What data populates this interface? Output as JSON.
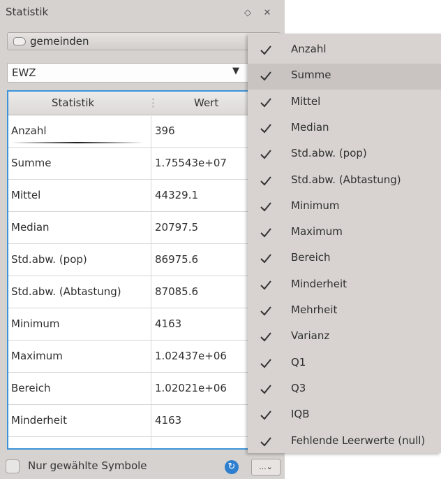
{
  "window": {
    "title": "Statistik"
  },
  "layer": {
    "name": "gemeinden"
  },
  "field": {
    "value": "EWZ"
  },
  "table": {
    "headers": [
      "Statistik",
      "Wert"
    ],
    "rows": [
      [
        "Anzahl",
        "396"
      ],
      [
        "Summe",
        "1.75543e+07"
      ],
      [
        "Mittel",
        "44329.1"
      ],
      [
        "Median",
        "20797.5"
      ],
      [
        "Std.abw. (pop)",
        "86975.6"
      ],
      [
        "Std.abw. (Abtastung)",
        "87085.6"
      ],
      [
        "Minimum",
        "4163"
      ],
      [
        "Maximum",
        "1.02437e+06"
      ],
      [
        "Bereich",
        "1.02021e+06"
      ],
      [
        "Minderheit",
        "4163"
      ]
    ]
  },
  "bottom": {
    "checkbox_label": "Nur gewählte Symbole",
    "more_label": "...⌄"
  },
  "menu": {
    "items": [
      "Anzahl",
      "Summe",
      "Mittel",
      "Median",
      "Std.abw. (pop)",
      "Std.abw. (Abtastung)",
      "Minimum",
      "Maximum",
      "Bereich",
      "Minderheit",
      "Mehrheit",
      "Varianz",
      "Q1",
      "Q3",
      "IQB",
      "Fehlende Leerwerte (null)"
    ],
    "checked": [
      true,
      true,
      true,
      true,
      true,
      true,
      true,
      true,
      true,
      true,
      true,
      true,
      true,
      true,
      true,
      true
    ],
    "highlighted": "Summe"
  },
  "colors": {
    "table_border": "#3d93d9",
    "panel_bg": "#d6d2d0",
    "menu_bg": "#d8d3d0",
    "menu_highlight": "#c9c4c1"
  },
  "icons": {
    "close": "close-icon",
    "float": "float-icon",
    "layer": "polygon-layer-icon",
    "refresh": "refresh-icon",
    "check": "check-icon"
  }
}
